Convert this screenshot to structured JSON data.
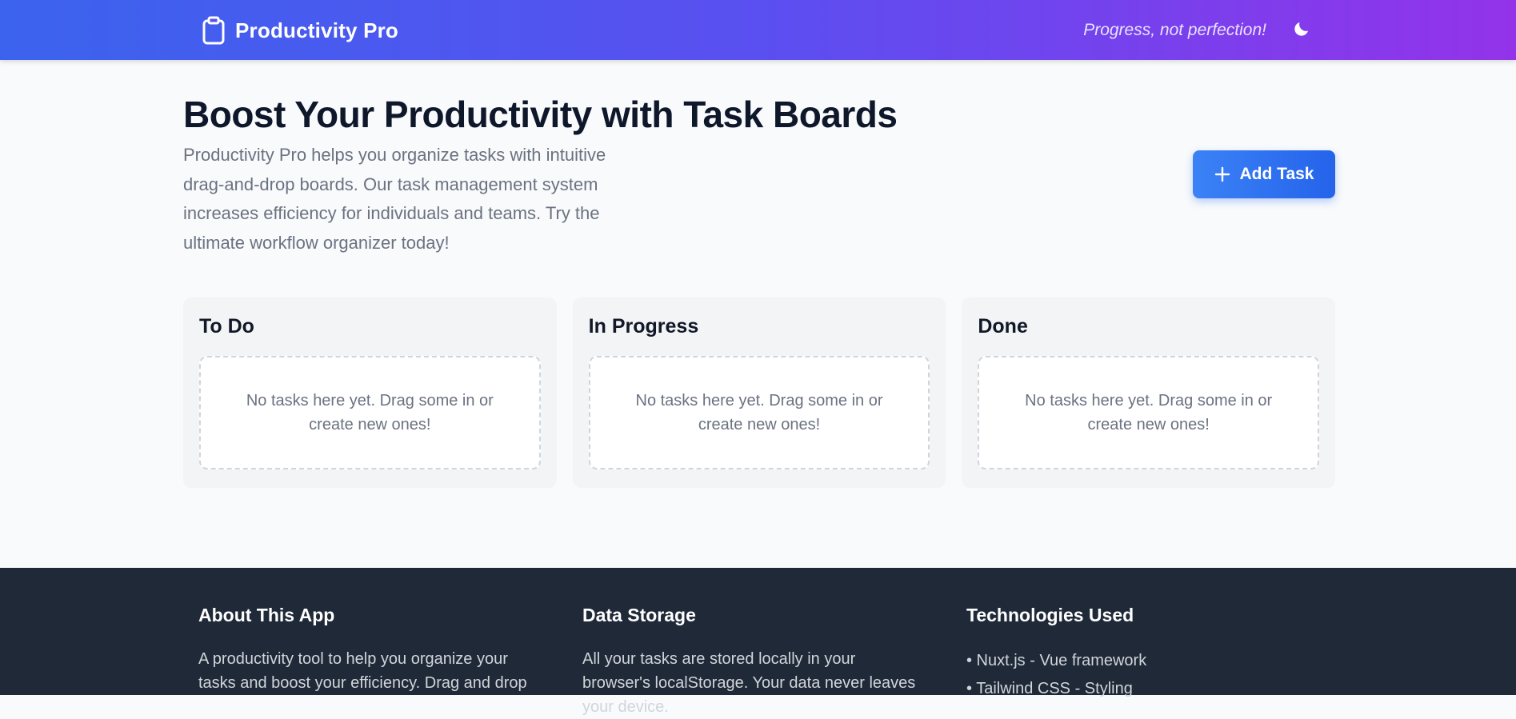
{
  "header": {
    "brand_title": "Productivity Pro",
    "tagline": "Progress, not perfection!",
    "brand_icon": "clipboard-icon",
    "theme_icon": "moon-icon"
  },
  "hero": {
    "title": "Boost Your Productivity with Task Boards",
    "description": "Productivity Pro helps you organize tasks with intuitive drag-and-drop boards. Our task management system increases efficiency for individuals and teams. Try the ultimate workflow organizer today!",
    "add_task_label": "Add Task"
  },
  "columns": [
    {
      "title": "To Do",
      "empty_text": "No tasks here yet. Drag some in or create new ones!"
    },
    {
      "title": "In Progress",
      "empty_text": "No tasks here yet. Drag some in or create new ones!"
    },
    {
      "title": "Done",
      "empty_text": "No tasks here yet. Drag some in or create new ones!"
    }
  ],
  "footer": {
    "about": {
      "title": "About This App",
      "text": "A productivity tool to help you organize your tasks and boost your efficiency. Drag and drop"
    },
    "storage": {
      "title": "Data Storage",
      "text": "All your tasks are stored locally in your browser's localStorage. Your data never leaves your device."
    },
    "tech": {
      "title": "Technologies Used",
      "items": [
        "• Nuxt.js - Vue framework",
        "• Tailwind CSS - Styling"
      ]
    }
  },
  "colors": {
    "accent": "#3b82f6",
    "gradient_start": "#3b63ee",
    "gradient_end": "#9333ea",
    "footer_bg": "#1f2937"
  }
}
